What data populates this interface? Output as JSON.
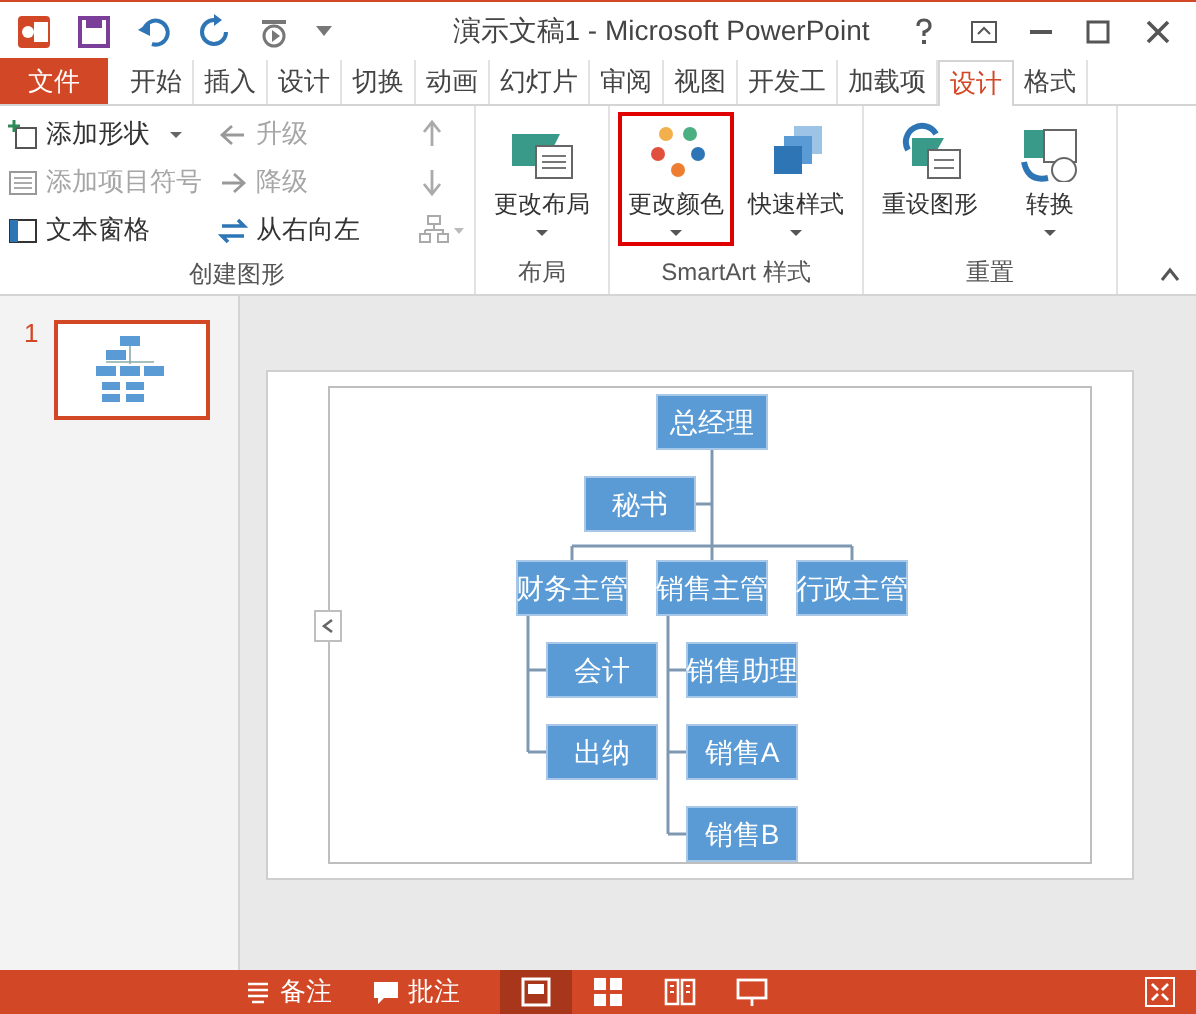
{
  "window": {
    "title": "演示文稿1 - Microsoft PowerPoint"
  },
  "file_tab": {
    "label": "文件"
  },
  "tabs": [
    {
      "label": "开始",
      "selected": false
    },
    {
      "label": "插入",
      "selected": false
    },
    {
      "label": "设计",
      "selected": false
    },
    {
      "label": "切换",
      "selected": false
    },
    {
      "label": "动画",
      "selected": false
    },
    {
      "label": "幻灯片",
      "selected": false
    },
    {
      "label": "审阅",
      "selected": false
    },
    {
      "label": "视图",
      "selected": false
    },
    {
      "label": "开发工",
      "selected": false
    },
    {
      "label": "加载项",
      "selected": false
    },
    {
      "label": "设计",
      "selected": true
    },
    {
      "label": "格式",
      "selected": false
    }
  ],
  "ribbon_groups": [
    {
      "label": "创建图形",
      "kind": "small",
      "items": [
        {
          "label": "添加形状",
          "dropdown": true,
          "disabled": false
        },
        {
          "label": "添加项目符号",
          "dropdown": false,
          "disabled": true
        },
        {
          "label": "文本窗格",
          "dropdown": false,
          "disabled": false
        },
        {
          "label": "升级",
          "dropdown": false,
          "disabled": true
        },
        {
          "label": "降级",
          "dropdown": false,
          "disabled": true
        },
        {
          "label": "从右向左",
          "dropdown": false,
          "disabled": false
        }
      ]
    },
    {
      "label": "布局",
      "kind": "large",
      "items": [
        {
          "label": "更改布局",
          "dropdown": true,
          "highlighted": false
        }
      ]
    },
    {
      "label": "SmartArt 样式",
      "kind": "large",
      "items": [
        {
          "label": "更改颜色",
          "dropdown": true,
          "highlighted": true
        },
        {
          "label": "快速样式",
          "dropdown": true,
          "highlighted": false
        }
      ]
    },
    {
      "label": "重置",
      "kind": "large",
      "items": [
        {
          "label": "重设图形",
          "dropdown": false,
          "highlighted": false
        },
        {
          "label": "转换",
          "dropdown": true,
          "highlighted": false
        }
      ]
    }
  ],
  "slides": [
    {
      "number": "1",
      "selected": true
    }
  ],
  "org_chart": {
    "root": {
      "label": "总经理",
      "assistant": {
        "label": "秘书"
      },
      "children": [
        {
          "label": "财务主管",
          "children": [
            {
              "label": "会计"
            },
            {
              "label": "出纳"
            }
          ]
        },
        {
          "label": "销售主管",
          "children": [
            {
              "label": "销售助理"
            },
            {
              "label": "销售A"
            },
            {
              "label": "销售B"
            }
          ]
        },
        {
          "label": "行政主管"
        }
      ]
    }
  },
  "status_bar": {
    "buttons": [
      {
        "label": "备注",
        "kind": "notes"
      },
      {
        "label": "批注",
        "kind": "comments"
      }
    ],
    "views": [
      {
        "kind": "normal",
        "selected": true
      },
      {
        "kind": "sorter",
        "selected": false
      },
      {
        "kind": "reading",
        "selected": false
      },
      {
        "kind": "show",
        "selected": false
      }
    ]
  }
}
